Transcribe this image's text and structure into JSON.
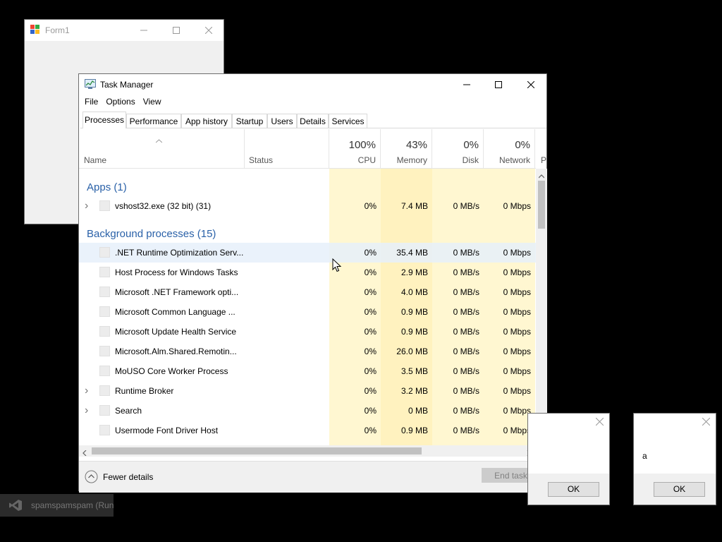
{
  "form1": {
    "title": "Form1"
  },
  "task_manager": {
    "title": "Task Manager",
    "menu": [
      "File",
      "Options",
      "View"
    ],
    "tabs": [
      "Processes",
      "Performance",
      "App history",
      "Startup",
      "Users",
      "Details",
      "Services"
    ],
    "active_tab": "Processes",
    "columns": {
      "name": "Name",
      "status": "Status",
      "cpu": {
        "pct": "100%",
        "label": "CPU"
      },
      "memory": {
        "pct": "43%",
        "label": "Memory"
      },
      "disk": {
        "pct": "0%",
        "label": "Disk"
      },
      "network": {
        "pct": "0%",
        "label": "Network"
      },
      "power": {
        "label": "P"
      }
    },
    "groups": {
      "apps": "Apps (1)",
      "background": "Background processes (15)"
    },
    "apps": [
      {
        "name": "vshost32.exe (32 bit) (31)",
        "cpu": "0%",
        "memory": "7.4 MB",
        "disk": "0 MB/s",
        "network": "0 Mbps",
        "expandable": true
      }
    ],
    "background": [
      {
        "name": ".NET Runtime Optimization Serv...",
        "cpu": "0%",
        "memory": "35.4 MB",
        "disk": "0 MB/s",
        "network": "0 Mbps",
        "expandable": false
      },
      {
        "name": "Host Process for Windows Tasks",
        "cpu": "0%",
        "memory": "2.9 MB",
        "disk": "0 MB/s",
        "network": "0 Mbps",
        "expandable": false
      },
      {
        "name": "Microsoft .NET Framework opti...",
        "cpu": "0%",
        "memory": "4.0 MB",
        "disk": "0 MB/s",
        "network": "0 Mbps",
        "expandable": false
      },
      {
        "name": "Microsoft Common Language ...",
        "cpu": "0%",
        "memory": "0.9 MB",
        "disk": "0 MB/s",
        "network": "0 Mbps",
        "expandable": false
      },
      {
        "name": "Microsoft Update Health Service",
        "cpu": "0%",
        "memory": "0.9 MB",
        "disk": "0 MB/s",
        "network": "0 Mbps",
        "expandable": false
      },
      {
        "name": "Microsoft.Alm.Shared.Remotin...",
        "cpu": "0%",
        "memory": "26.0 MB",
        "disk": "0 MB/s",
        "network": "0 Mbps",
        "expandable": false
      },
      {
        "name": "MoUSO Core Worker Process",
        "cpu": "0%",
        "memory": "3.5 MB",
        "disk": "0 MB/s",
        "network": "0 Mbps",
        "expandable": false
      },
      {
        "name": "Runtime Broker",
        "cpu": "0%",
        "memory": "3.2 MB",
        "disk": "0 MB/s",
        "network": "0 Mbps",
        "expandable": true
      },
      {
        "name": "Search",
        "cpu": "0%",
        "memory": "0 MB",
        "disk": "0 MB/s",
        "network": "0 Mbps",
        "expandable": true
      },
      {
        "name": "Usermode Font Driver Host",
        "cpu": "0%",
        "memory": "0.9 MB",
        "disk": "0 MB/s",
        "network": "0 Mbps",
        "expandable": false
      }
    ],
    "fewer_details": "Fewer details",
    "end_task": "End task"
  },
  "msgbox1": {
    "ok": "OK"
  },
  "msgbox2": {
    "text": "a",
    "ok": "OK"
  },
  "taskbar_thumb": {
    "label": "spamspamspam (Run"
  },
  "colors": {
    "cpu_col": "#fff4c4",
    "mem_col": "#ffefb0",
    "group_text": "#2a61a8",
    "row_hover": "#eaf2fb"
  }
}
